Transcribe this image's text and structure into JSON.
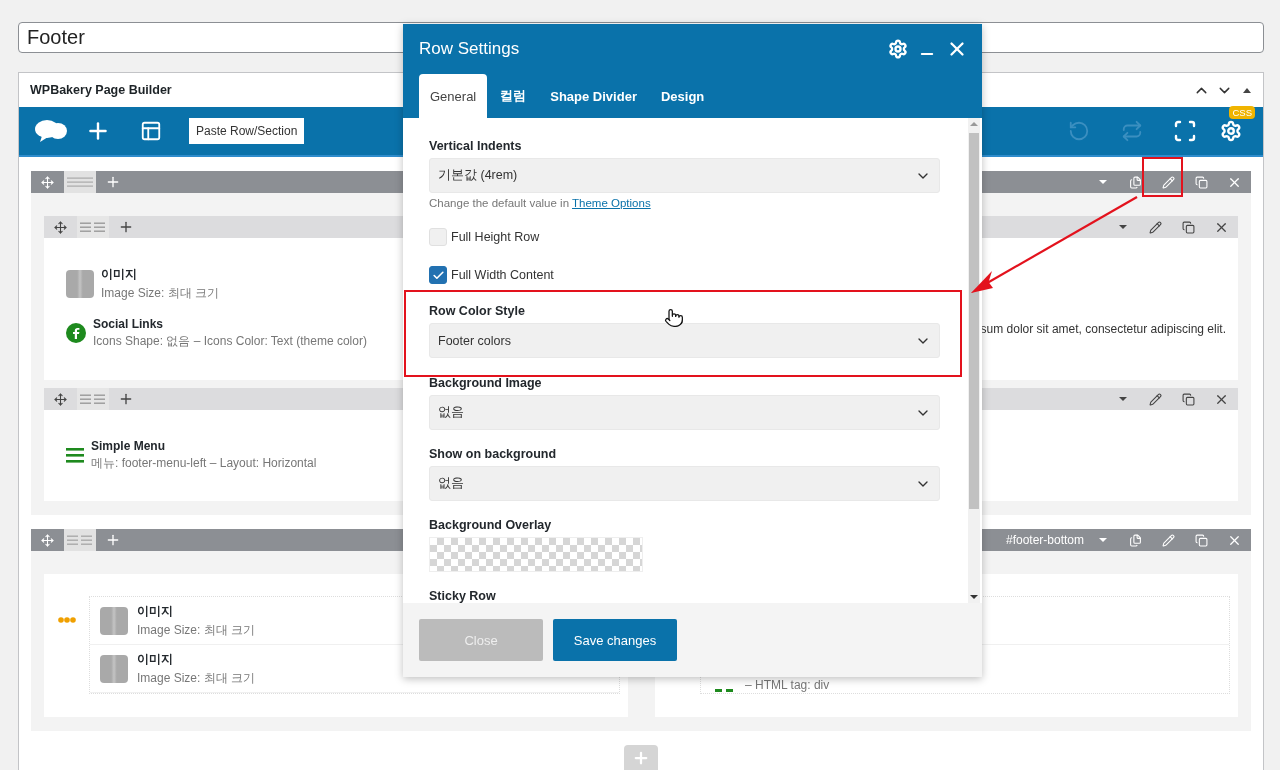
{
  "page_title": "Footer",
  "builder": {
    "title": "WPBakery Page Builder",
    "paste_button": "Paste Row/Section",
    "css_badge": "CSS",
    "undo_disabled": true,
    "redo_disabled": true
  },
  "rows": [
    {
      "kind": "nested",
      "edit_highlighted": true,
      "inner_rows": [
        {
          "columns": [
            {
              "kind": "plain",
              "elements": [
                {
                  "kind": "image",
                  "title": "이미지",
                  "detail": "Image Size: 최대 크기"
                },
                {
                  "kind": "social",
                  "title": "Social Links",
                  "detail": "Icons Shape: 없음 – Icons Color: Text (theme color)"
                }
              ]
            },
            {
              "kind": "plain",
              "elements": [
                {
                  "kind": "text",
                  "detail": "sum dolor sit amet, consectetur adipiscing elit."
                }
              ]
            }
          ]
        },
        {
          "columns": [
            {
              "kind": "plain",
              "elements": [
                {
                  "kind": "menu",
                  "title": "Simple Menu",
                  "detail": "메뉴: footer-menu-left – Layout: Horizontal"
                }
              ]
            },
            {
              "kind": "plain"
            }
          ]
        }
      ]
    },
    {
      "kind": "columns",
      "id_label": "#footer-bottom",
      "edit_highlighted": false,
      "columns": [
        {
          "kind": "group",
          "elements": [
            {
              "kind": "image",
              "title": "이미지",
              "detail": "Image Size: 최대 크기"
            },
            {
              "kind": "image",
              "title": "이미지",
              "detail": "Image Size: 최대 크기"
            }
          ]
        },
        {
          "kind": "list",
          "elements": [
            {
              "kind": "blank"
            },
            {
              "kind": "html",
              "detail": "– HTML tag: div"
            }
          ]
        }
      ]
    }
  ],
  "modal": {
    "title": "Row Settings",
    "tabs": [
      {
        "label": "General",
        "selected": true
      },
      {
        "label": "컬럼",
        "selected": false
      },
      {
        "label": "Shape Divider",
        "selected": false
      },
      {
        "label": "Design",
        "selected": false
      }
    ],
    "fields": [
      {
        "kind": "select",
        "label": "Vertical Indents",
        "value": "기본값 (4rem)",
        "highlighted": false
      },
      {
        "kind": "help",
        "text": "Change the default value in",
        "link": "Theme Options"
      },
      {
        "kind": "checkbox",
        "label": "Full Height Row",
        "checked": false
      },
      {
        "kind": "checkbox",
        "label": "Full Width Content",
        "checked": true
      },
      {
        "kind": "select",
        "label": "Row Color Style",
        "value": "Footer colors",
        "highlighted": true
      },
      {
        "kind": "select",
        "label": "Background Image",
        "value": "없음",
        "highlighted": false
      },
      {
        "kind": "select",
        "label": "Show on background",
        "value": "없음",
        "highlighted": false
      },
      {
        "kind": "color",
        "label": "Background Overlay"
      },
      {
        "kind": "heading",
        "label": "Sticky Row"
      }
    ],
    "buttons": [
      {
        "kind": "secondary",
        "label": "Close"
      },
      {
        "kind": "primary",
        "label": "Save changes"
      }
    ]
  }
}
